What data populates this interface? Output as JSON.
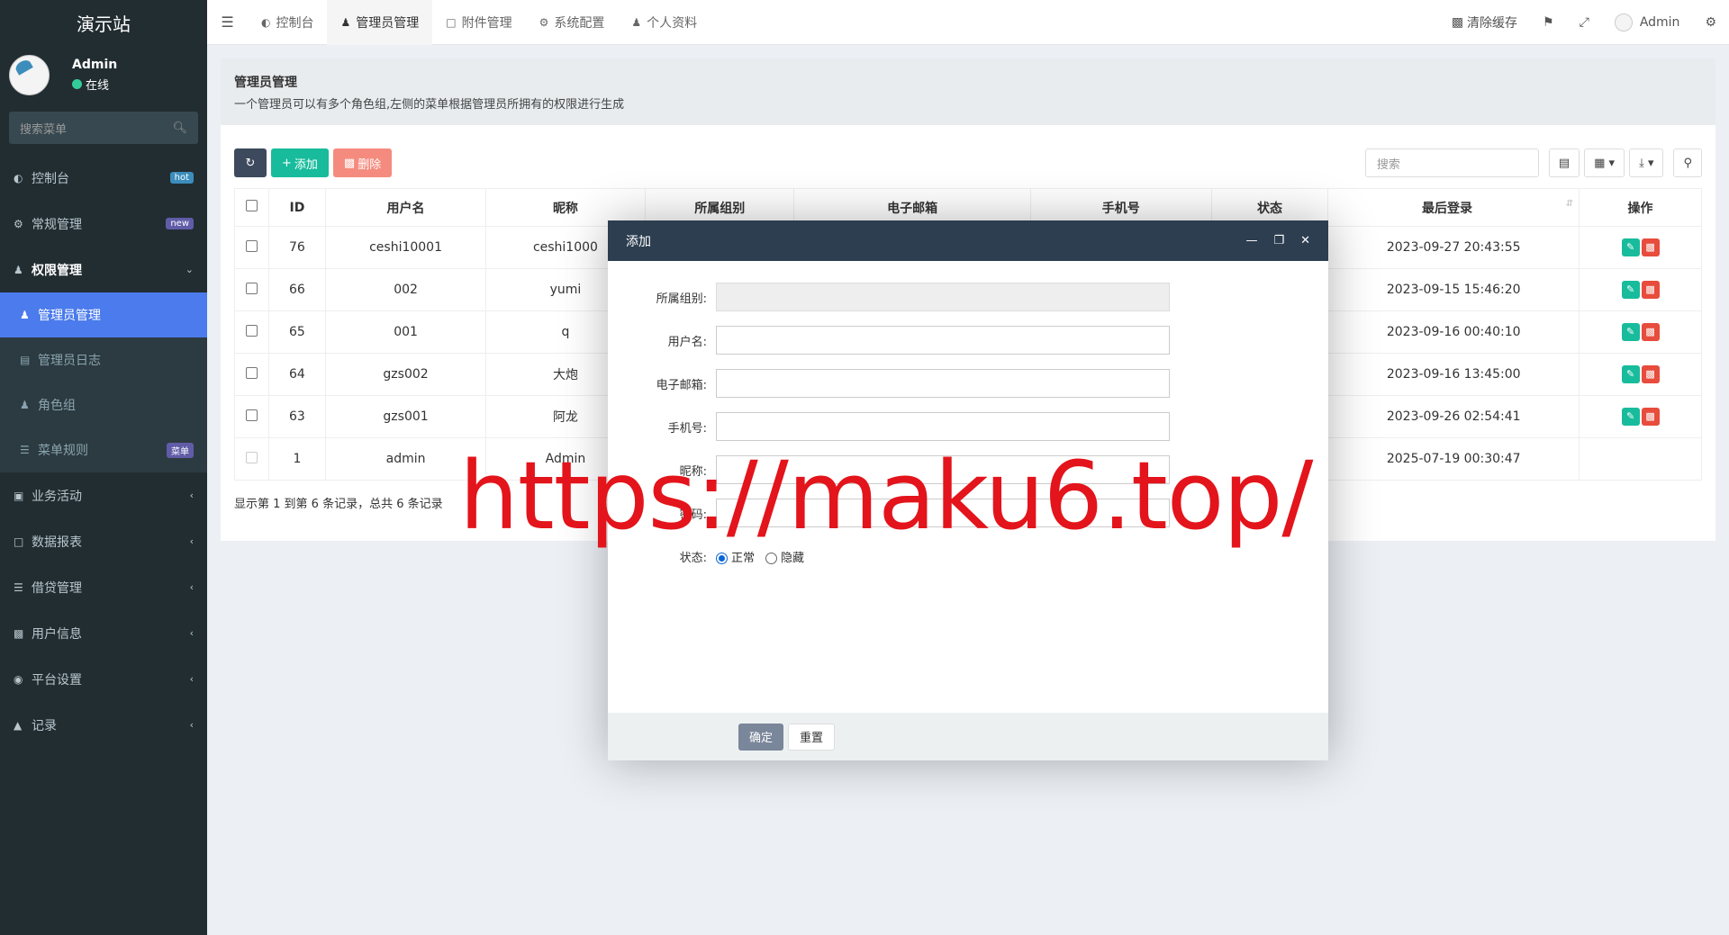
{
  "sidebar": {
    "brand": "演示站",
    "user": {
      "name": "Admin",
      "status": "在线"
    },
    "search_placeholder": "搜索菜单",
    "menu": [
      {
        "label": "控制台",
        "icon": "dashboard-icon",
        "badge": "hot"
      },
      {
        "label": "常规管理",
        "icon": "cogs-icon",
        "badge": "new"
      },
      {
        "label": "权限管理",
        "icon": "users-icon",
        "expanded": true
      },
      {
        "label": "业务活动",
        "icon": "id-card-icon"
      },
      {
        "label": "数据报表",
        "icon": "file-icon"
      },
      {
        "label": "借贷管理",
        "icon": "list-icon"
      },
      {
        "label": "用户信息",
        "icon": "address-book-icon"
      },
      {
        "label": "平台设置",
        "icon": "dot-circle-icon"
      },
      {
        "label": "记录",
        "icon": "area-chart-icon"
      }
    ],
    "submenu": [
      {
        "label": "管理员管理",
        "icon": "user-icon",
        "active": true
      },
      {
        "label": "管理员日志",
        "icon": "list-alt-icon"
      },
      {
        "label": "角色组",
        "icon": "group-icon"
      },
      {
        "label": "菜单规则",
        "icon": "bars-icon",
        "badge": "菜单"
      }
    ]
  },
  "navbar": {
    "tabs": [
      {
        "label": "控制台",
        "icon": "dashboard-icon"
      },
      {
        "label": "管理员管理",
        "icon": "user-icon",
        "active": true
      },
      {
        "label": "附件管理",
        "icon": "file-image-icon"
      },
      {
        "label": "系统配置",
        "icon": "cog-icon"
      },
      {
        "label": "个人资料",
        "icon": "user-icon"
      }
    ],
    "clear_cache": "清除缓存",
    "user_name": "Admin"
  },
  "page": {
    "title": "管理员管理",
    "description": "一个管理员可以有多个角色组,左侧的菜单根据管理员所拥有的权限进行生成"
  },
  "toolbar": {
    "add": "添加",
    "delete": "删除",
    "search_placeholder": "搜索"
  },
  "table": {
    "columns": [
      "ID",
      "用户名",
      "昵称",
      "所属组别",
      "电子邮箱",
      "手机号",
      "状态",
      "最后登录",
      "操作"
    ],
    "rows": [
      {
        "id": "76",
        "username": "ceshi10001",
        "nickname": "ceshi1000",
        "last_login": "2023-09-27 20:43:55"
      },
      {
        "id": "66",
        "username": "002",
        "nickname": "yumi",
        "last_login": "2023-09-15 15:46:20"
      },
      {
        "id": "65",
        "username": "001",
        "nickname": "q",
        "last_login": "2023-09-16 00:40:10"
      },
      {
        "id": "64",
        "username": "gzs002",
        "nickname": "大炮",
        "last_login": "2023-09-16 13:45:00"
      },
      {
        "id": "63",
        "username": "gzs001",
        "nickname": "阿龙",
        "last_login": "2023-09-26 02:54:41"
      },
      {
        "id": "1",
        "username": "admin",
        "nickname": "Admin",
        "last_login": "2025-07-19 00:30:47"
      }
    ],
    "summary": "显示第 1 到第 6 条记录，总共 6 条记录"
  },
  "modal": {
    "title": "添加",
    "fields": [
      "所属组别:",
      "用户名:",
      "电子邮箱:",
      "手机号:",
      "昵称:",
      "密码:"
    ],
    "status_label": "状态:",
    "status_options": [
      "正常",
      "隐藏"
    ],
    "confirm": "确定",
    "reset": "重置"
  },
  "watermark": "https://maku6.top/"
}
